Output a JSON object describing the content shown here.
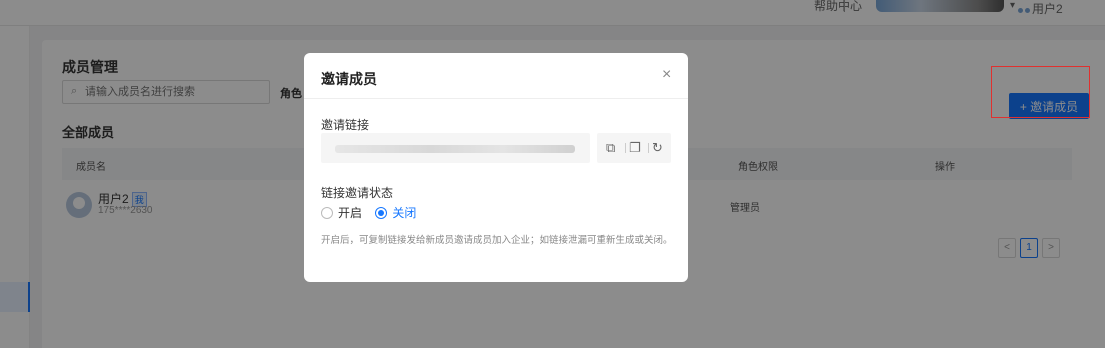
{
  "topbar": {
    "help": "帮助中心",
    "user": "用户2"
  },
  "page": {
    "title": "成员管理",
    "search_placeholder": "请输入成员名进行搜索",
    "role_filter_label": "角色",
    "invite_button": "+ 邀请成员",
    "all_members_title": "全部成员",
    "columns": [
      "成员名",
      "角色权限",
      "操作"
    ],
    "rows": [
      {
        "name": "用户2",
        "badge": "我",
        "phone": "175****2630",
        "role": "管理员"
      }
    ],
    "pager": {
      "prev": "<",
      "current": "1",
      "next": ">"
    }
  },
  "modal": {
    "title": "邀请成员",
    "close": "×",
    "link_label": "邀请链接",
    "icons": [
      "copy-link-icon",
      "copy-icon",
      "refresh-icon"
    ],
    "status_label": "链接邀请状态",
    "options": [
      {
        "label": "开启",
        "selected": false
      },
      {
        "label": "关闭",
        "selected": true
      }
    ],
    "hint": "开启后，可复制链接发给新成员邀请成员加入企业；如链接泄漏可重新生成或关闭。"
  },
  "colors": {
    "primary": "#1677ff",
    "highlight_border": "#e0312f"
  }
}
